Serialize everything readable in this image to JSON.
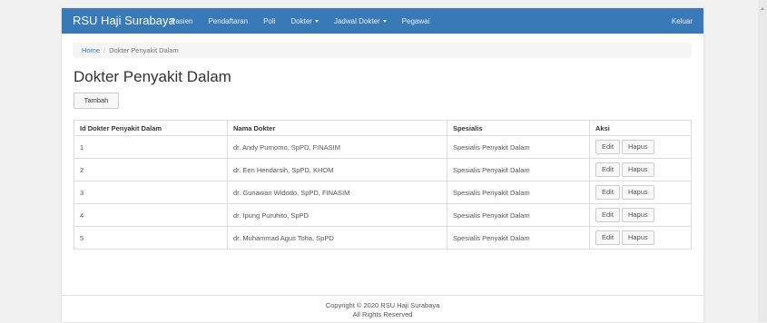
{
  "navbar": {
    "brand": "RSU Haji Surabaya",
    "links": [
      "Pasien",
      "Pendaftaran",
      "Poli",
      "Dokter",
      "Jadwal Dokter",
      "Pegawai"
    ],
    "logout": "Keluar"
  },
  "breadcrumb": {
    "home": "Home",
    "current": "Dokter Penyakit Dalam"
  },
  "page_title": "Dokter Penyakit Dalam",
  "add_button": "Tambah",
  "table": {
    "headers": [
      "Id Dokter Penyakit Dalam",
      "Nama Dokter",
      "Spesialis",
      "Aksi"
    ],
    "rows": [
      {
        "id": "1",
        "name": "dr. Andy Purnomo, SpPD, FINASIM",
        "spec": "Spesialis Penyakit Dalam"
      },
      {
        "id": "2",
        "name": "dr. Een Hendarsih, SpPD, KHOM",
        "spec": "Spesialis Penyakit Dalam"
      },
      {
        "id": "3",
        "name": "dr. Gunawan Widodo, SpPD, FINASIM",
        "spec": "Spesialis Penyakit Dalam"
      },
      {
        "id": "4",
        "name": "dr. Ipung Puruhito, SpPD",
        "spec": "Spesialis Penyakit Dalam"
      },
      {
        "id": "5",
        "name": "dr. Muhammad Agus Toha, SpPD",
        "spec": "Spesialis Penyakit Dalam"
      }
    ],
    "edit_label": "Edit",
    "delete_label": "Hapus"
  },
  "footer": {
    "line1": "Copyright © 2020 RSU Haji Surabaya",
    "line2": "All Rights Reserved"
  }
}
